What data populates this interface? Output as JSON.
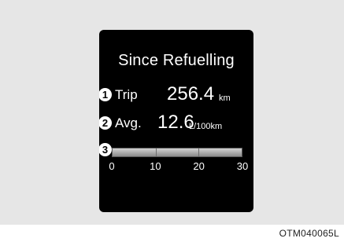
{
  "display": {
    "title": "Since Refuelling",
    "trip": {
      "marker": "1",
      "label": "Trip",
      "value": "256.4",
      "unit": "km"
    },
    "avg": {
      "marker": "2",
      "label": "Avg.",
      "value": "12.6",
      "unit": "L/100km"
    },
    "gauge": {
      "marker": "3",
      "ticks": [
        "0",
        "10",
        "20",
        "30"
      ],
      "range": [
        0,
        30
      ],
      "level": 30
    }
  },
  "figure_code": "OTM040065L",
  "colors": {
    "screen": "#000000",
    "surround": "#e6e6e6",
    "text": "#ffffff"
  }
}
